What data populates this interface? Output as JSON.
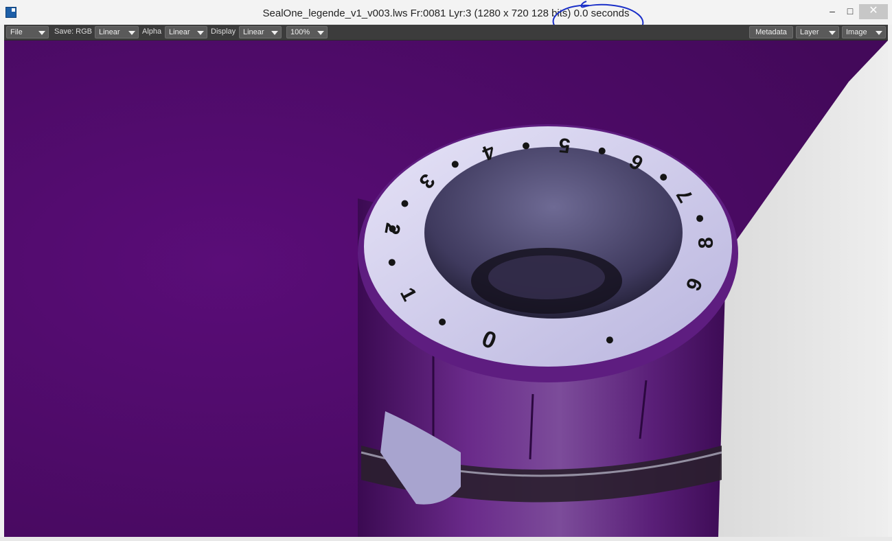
{
  "window": {
    "title": "SealOne_legende_v1_v003.lws Fr:0081 Lyr:3  (1280 x 720 128 bits) 0.0 seconds",
    "minimize": "–",
    "maximize": "□",
    "close": "✕"
  },
  "toolbar": {
    "file": "File",
    "save_label": "Save: RGB",
    "save_value": "Linear",
    "alpha_label": "Alpha",
    "alpha_value": "Linear",
    "display_label": "Display",
    "display_value": "Linear",
    "zoom_value": "100%",
    "metadata": "Metadata",
    "layer": "Layer",
    "image": "Image"
  },
  "render": {
    "dial_digits": [
      "0",
      "1",
      "2",
      "3",
      "4",
      "5",
      "6",
      "7",
      "8",
      "9"
    ],
    "background_color": "#4b0a64",
    "ring_color": "#c9c6ea",
    "annotation_color": "#1a2fc8"
  }
}
